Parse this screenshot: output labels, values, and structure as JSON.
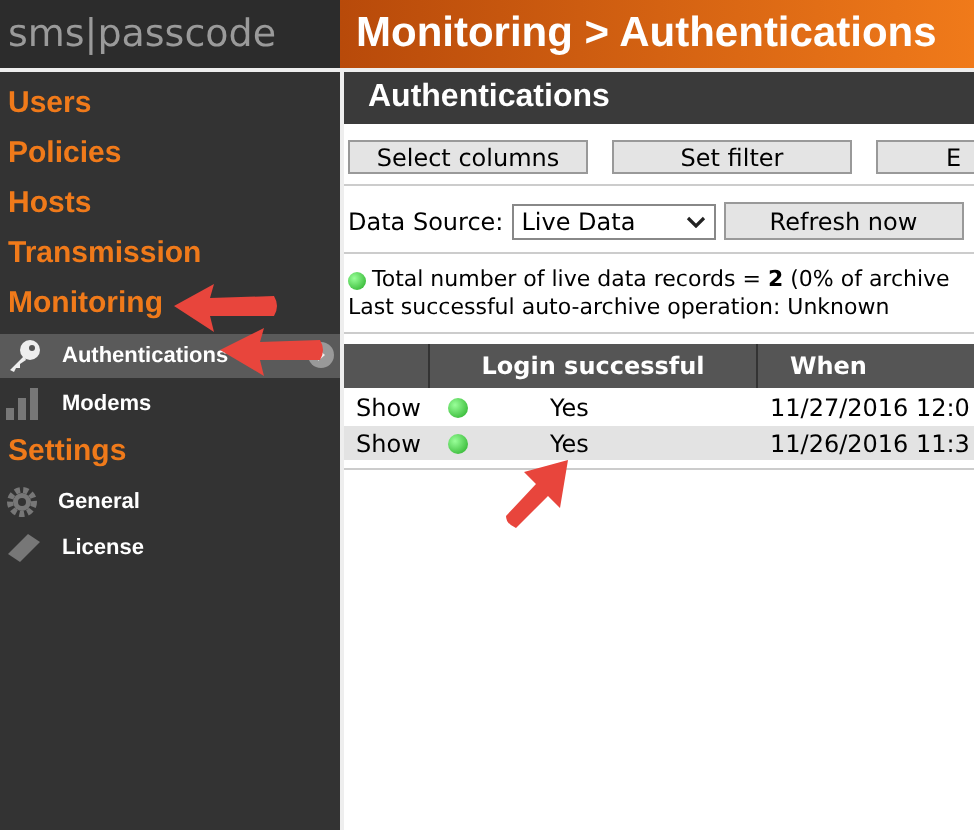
{
  "header": {
    "logo": "sms|passcode",
    "title": "Monitoring > Authentications"
  },
  "sidebar": {
    "items": [
      {
        "kind": "section",
        "label": "Users",
        "selected": false
      },
      {
        "kind": "section",
        "label": "Policies",
        "selected": false
      },
      {
        "kind": "section",
        "label": "Hosts",
        "selected": false
      },
      {
        "kind": "section",
        "label": "Transmission",
        "selected": false
      },
      {
        "kind": "section",
        "label": "Monitoring",
        "selected": false
      },
      {
        "kind": "item",
        "label": "Authentications",
        "selected": true
      },
      {
        "kind": "item",
        "label": "Modems",
        "selected": false
      },
      {
        "kind": "section",
        "label": "Settings",
        "selected": false
      },
      {
        "kind": "item",
        "label": "General",
        "selected": false
      },
      {
        "kind": "item",
        "label": "License",
        "selected": false
      }
    ]
  },
  "panel": {
    "title": "Authentications",
    "buttons": [
      "Select columns",
      "Set filter",
      "E"
    ],
    "data_source": {
      "label": "Data Source:",
      "value": "Live Data"
    },
    "refresh_button": "Refresh now",
    "status": "Total number of live data records = **2** (0% of archive",
    "archive_status": "Last successful auto-archive operation: Unknown",
    "table": {
      "columns": [
        "Login successful",
        "When"
      ],
      "rows": [
        {
          "action": "Show",
          "ok": true,
          "login": "Yes",
          "when": "11/27/2016 12:0",
          "selected": false
        },
        {
          "action": "Show",
          "ok": true,
          "login": "Yes",
          "when": "11/26/2016 11:3",
          "selected": true
        }
      ]
    }
  }
}
